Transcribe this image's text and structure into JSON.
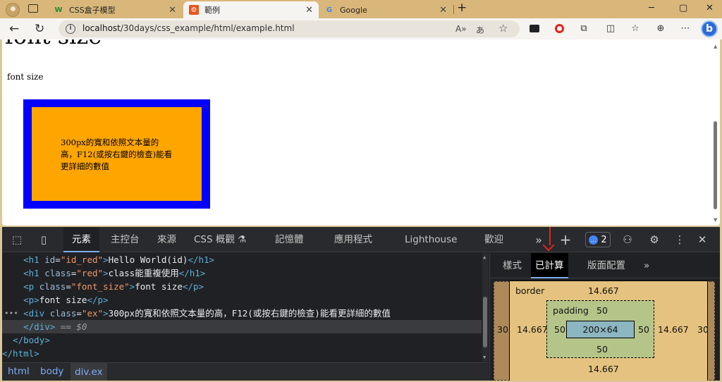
{
  "browser": {
    "tabs": [
      {
        "title": "CSS盒子模型",
        "favicon": "W",
        "active": false
      },
      {
        "title": "範例",
        "favicon": "⚙",
        "active": true
      },
      {
        "title": "Google",
        "favicon": "G",
        "active": false
      }
    ],
    "new_tab": "+",
    "window_controls": {
      "minimize": "─",
      "maximize": "▢",
      "close": "✕"
    },
    "address": {
      "host": "localhost",
      "path": "/30days/css_example/html/example.html"
    }
  },
  "page": {
    "heading": "font size",
    "paragraph": "font size",
    "ex_box_text": "300px的寬和依照文本量的高，F12(或按右鍵的檢查)能看更詳細的數值",
    "colors": {
      "ex_border": "#0000ff",
      "ex_bg": "#ffa500"
    }
  },
  "devtools": {
    "tabs": [
      "元素",
      "主控台",
      "來源",
      "CSS 概觀 ⚗",
      "記憶體",
      "應用程式",
      "Lighthouse",
      "歡迎"
    ],
    "active_tab": "元素",
    "issues_count": "2",
    "code_lines": [
      {
        "indent": "    ",
        "open": "<h1 ",
        "attr": "id",
        "val": "\"id_red\"",
        "close": ">",
        "text": "Hello World(id)",
        "end": "</h1>"
      },
      {
        "indent": "    ",
        "open": "<h1 ",
        "attr": "class",
        "val": "\"red\"",
        "close": ">",
        "text": "class能重複使用",
        "end": "</h1>"
      },
      {
        "indent": "    ",
        "open": "<p ",
        "attr": "class",
        "val": "\"font_size\"",
        "close": ">",
        "text": "font size",
        "end": "</p>"
      },
      {
        "indent": "    ",
        "open": "<p",
        "attr": "",
        "val": "",
        "close": ">",
        "text": "font size",
        "end": "</p>"
      },
      {
        "indent": "    ",
        "open": "<div ",
        "attr": "class",
        "val": "\"ex\"",
        "close": ">",
        "text": "300px的寬和依照文本量的高，F12(或按右鍵的檢查)能看更詳細的數值",
        "end": ""
      },
      {
        "indent": "    ",
        "open": "</div>",
        "attr": "",
        "val": "",
        "close": "",
        "text": "",
        "end": "",
        "eq": " == $0"
      },
      {
        "indent": "  ",
        "open": "</body>",
        "attr": "",
        "val": "",
        "close": "",
        "text": "",
        "end": ""
      },
      {
        "indent": "",
        "open": "</html>",
        "attr": "",
        "val": "",
        "close": "",
        "text": "",
        "end": ""
      }
    ],
    "breadcrumb": [
      "html",
      "body",
      "div.ex"
    ],
    "side_tabs": [
      "樣式",
      "已計算",
      "版面配置"
    ],
    "side_active": "已計算",
    "box_model": {
      "margin_left": "30",
      "margin_right": "30",
      "border_label": "border",
      "border_top": "14.667",
      "border_bottom": "14.667",
      "border_left": "14.667",
      "border_right": "14.667",
      "padding_label": "padding",
      "padding_top": "50",
      "padding_bottom": "50",
      "padding_left": "50",
      "padding_right": "50",
      "content": "200×64"
    }
  }
}
